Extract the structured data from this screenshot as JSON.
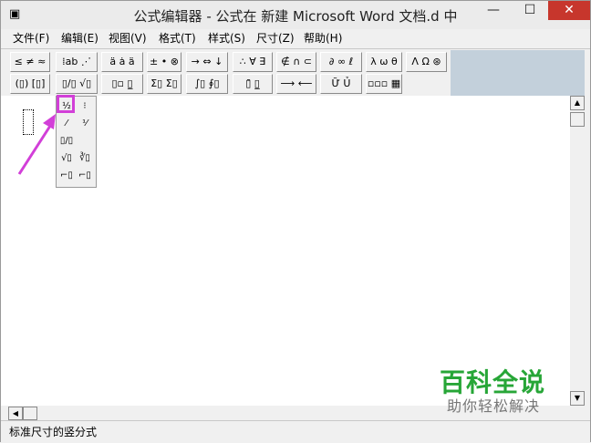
{
  "window": {
    "title": "公式编辑器 - 公式在 新建 Microsoft Word 文档.d 中",
    "controls": {
      "minimize": "—",
      "maximize": "☐",
      "close": "✕"
    }
  },
  "menu": [
    "文件(F)",
    "编辑(E)",
    "视图(V)",
    "格式(T)",
    "样式(S)",
    "尺寸(Z)",
    "帮助(H)"
  ],
  "toolbar": {
    "row1": [
      {
        "name": "relational-symbols",
        "label": "≤ ≠ ≈"
      },
      {
        "name": "spaces-ellipses",
        "label": "⁞ab ⋰"
      },
      {
        "name": "embellishments",
        "label": "ä ȧ ä"
      },
      {
        "name": "operator-symbols",
        "label": "± • ⊗"
      },
      {
        "name": "arrow-symbols",
        "label": "→ ⇔ ↓"
      },
      {
        "name": "logical-symbols",
        "label": "∴ ∀ ∃"
      },
      {
        "name": "set-theory-symbols",
        "label": "∉ ∩ ⊂"
      },
      {
        "name": "misc-symbols",
        "label": "∂ ∞ ℓ"
      },
      {
        "name": "greek-lowercase",
        "label": "λ ω θ"
      },
      {
        "name": "greek-uppercase",
        "label": "Λ Ω ⊛"
      }
    ],
    "row2": [
      {
        "name": "fence-templates",
        "label": "(▯) [▯]"
      },
      {
        "name": "fraction-radical-templates",
        "label": "▯/▯ √▯"
      },
      {
        "name": "script-templates",
        "label": "▯▫ ▯̲"
      },
      {
        "name": "summation-templates",
        "label": "Σ▯ Σ▯"
      },
      {
        "name": "integral-templates",
        "label": "∫▯ ∮▯"
      },
      {
        "name": "underbar-overbar-templates",
        "label": "▯̄ ▯̲"
      },
      {
        "name": "labeled-arrow-templates",
        "label": "⟶ ⟵"
      },
      {
        "name": "products-set-templates",
        "label": "Ữ Ủ"
      },
      {
        "name": "matrix-templates",
        "label": "▫▫▫ ▦"
      }
    ]
  },
  "palette": {
    "items": [
      "½",
      "⁝",
      "⁄",
      "⅟",
      "▯/▯",
      "",
      "√▯",
      "∛▯",
      "⌐▯",
      "⌐▯"
    ]
  },
  "status": "标准尺寸的竖分式",
  "watermark": {
    "title": "百科全说",
    "subtitle": "助你轻松解决"
  }
}
